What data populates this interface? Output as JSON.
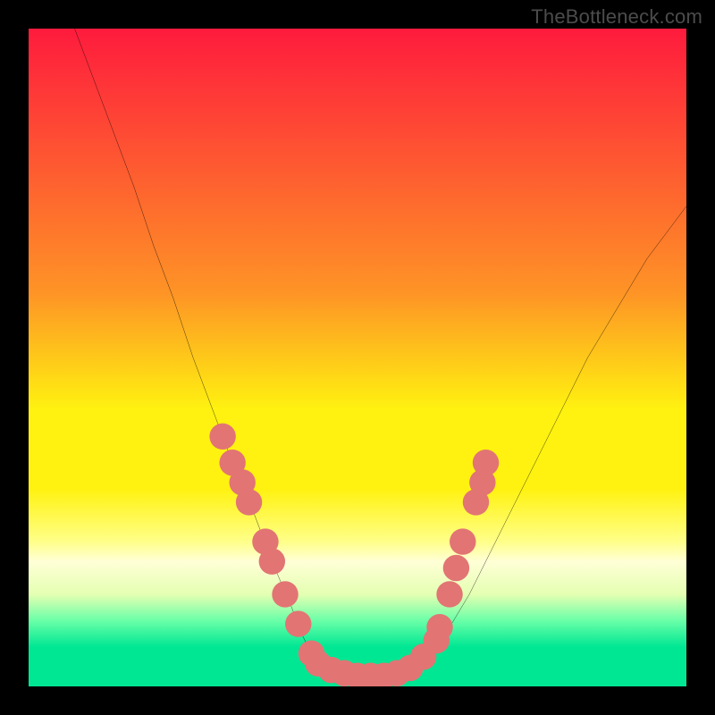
{
  "watermark": "TheBottleneck.com",
  "chart_data": {
    "type": "line",
    "title": "",
    "xlabel": "",
    "ylabel": "",
    "xlim": [
      0,
      100
    ],
    "ylim": [
      0,
      100
    ],
    "gradient_bands": [
      {
        "y": 100,
        "color": "#fe1b3d"
      },
      {
        "y": 60,
        "color": "#fe9326"
      },
      {
        "y": 42,
        "color": "#fff210"
      },
      {
        "y": 30,
        "color": "#fff210"
      },
      {
        "y": 22,
        "color": "#ffff89"
      },
      {
        "y": 19,
        "color": "#ffffd6"
      },
      {
        "y": 14,
        "color": "#e4ffb2"
      },
      {
        "y": 10,
        "color": "#6affa8"
      },
      {
        "y": 6,
        "color": "#00e793"
      },
      {
        "y": 0,
        "color": "#00e793"
      }
    ],
    "curve": {
      "x": [
        7,
        10,
        13,
        16,
        19,
        22,
        25,
        28,
        31,
        34,
        37,
        40,
        41.5,
        43,
        46,
        49,
        52,
        55,
        58,
        61,
        64,
        67,
        70,
        73,
        76,
        79,
        82,
        85,
        88,
        91,
        94,
        97,
        100
      ],
      "y": [
        100,
        92,
        84,
        76,
        67,
        59,
        50,
        42,
        34,
        27,
        19,
        12,
        8,
        5,
        3,
        2,
        1.6,
        1.6,
        2.6,
        5,
        9,
        14,
        20,
        26,
        32,
        38,
        44,
        50,
        55,
        60,
        65,
        69,
        73
      ]
    },
    "markers": [
      {
        "x": 29.5,
        "y": 38
      },
      {
        "x": 31,
        "y": 34
      },
      {
        "x": 32.5,
        "y": 31
      },
      {
        "x": 33.5,
        "y": 28
      },
      {
        "x": 36,
        "y": 22
      },
      {
        "x": 37,
        "y": 19
      },
      {
        "x": 39,
        "y": 14
      },
      {
        "x": 41,
        "y": 9.5
      },
      {
        "x": 43,
        "y": 5
      },
      {
        "x": 44,
        "y": 3.5
      },
      {
        "x": 46,
        "y": 2.5
      },
      {
        "x": 48,
        "y": 2
      },
      {
        "x": 50,
        "y": 1.6
      },
      {
        "x": 52,
        "y": 1.6
      },
      {
        "x": 54,
        "y": 1.6
      },
      {
        "x": 56,
        "y": 2
      },
      {
        "x": 58,
        "y": 2.8
      },
      {
        "x": 60,
        "y": 4.5
      },
      {
        "x": 62,
        "y": 7
      },
      {
        "x": 62.5,
        "y": 9
      },
      {
        "x": 64,
        "y": 14
      },
      {
        "x": 65,
        "y": 18
      },
      {
        "x": 66,
        "y": 22
      },
      {
        "x": 68,
        "y": 28
      },
      {
        "x": 69,
        "y": 31
      },
      {
        "x": 69.5,
        "y": 34
      }
    ],
    "marker_style": {
      "fill": "#e27474",
      "r": 2.0
    }
  }
}
